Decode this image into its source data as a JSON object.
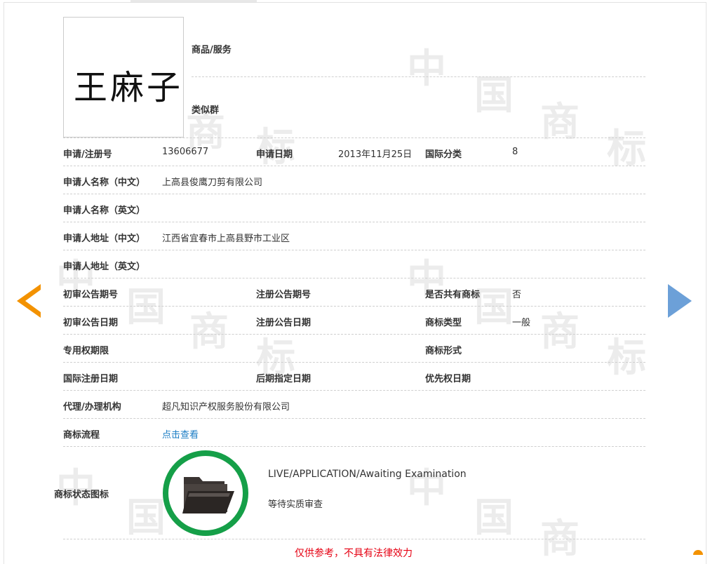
{
  "brand": {
    "accent_orange": "#f39200",
    "accent_blue": "#6ca0d8",
    "status_green": "#159f48",
    "link_blue": "#1a7cc4",
    "warning_red": "#e60012"
  },
  "watermark": {
    "chars": [
      "中",
      "国",
      "商",
      "标"
    ]
  },
  "trademark": {
    "image_text": "王麻子"
  },
  "goods_label": "商品/服务",
  "similar_group_label": "类似群",
  "fields": {
    "reg_no_label": "申请/注册号",
    "reg_no": "13606677",
    "app_date_label": "申请日期",
    "app_date": "2013年11月25日",
    "intl_class_label": "国际分类",
    "intl_class": "8",
    "applicant_cn_label": "申请人名称（中文）",
    "applicant_cn": "上高县俊鹰刀剪有限公司",
    "applicant_en_label": "申请人名称（英文）",
    "applicant_en": "",
    "address_cn_label": "申请人地址（中文）",
    "address_cn": "江西省宜春市上高县野市工业区",
    "address_en_label": "申请人地址（英文）",
    "address_en": "",
    "prelim_pub_no_label": "初审公告期号",
    "prelim_pub_no": "",
    "reg_pub_no_label": "注册公告期号",
    "reg_pub_no": "",
    "shared_label": "是否共有商标",
    "shared": "否",
    "prelim_pub_date_label": "初审公告日期",
    "prelim_pub_date": "",
    "reg_pub_date_label": "注册公告日期",
    "reg_pub_date": "",
    "tm_type_label": "商标类型",
    "tm_type": "一般",
    "exclusive_period_label": "专用权期限",
    "exclusive_period": "",
    "tm_form_label": "商标形式",
    "tm_form": "",
    "intl_reg_date_label": "国际注册日期",
    "intl_reg_date": "",
    "later_designation_label": "后期指定日期",
    "later_designation": "",
    "priority_date_label": "优先权日期",
    "priority_date": "",
    "agency_label": "代理/办理机构",
    "agency": "超凡知识产权服务股份有限公司",
    "process_label": "商标流程",
    "process_link": "点击查看"
  },
  "status": {
    "label": "商标状态图标",
    "icon": "folder-icon",
    "english": "LIVE/APPLICATION/Awaiting Examination",
    "chinese": "等待实质审查"
  },
  "footnote": "仅供参考，不具有法律效力"
}
